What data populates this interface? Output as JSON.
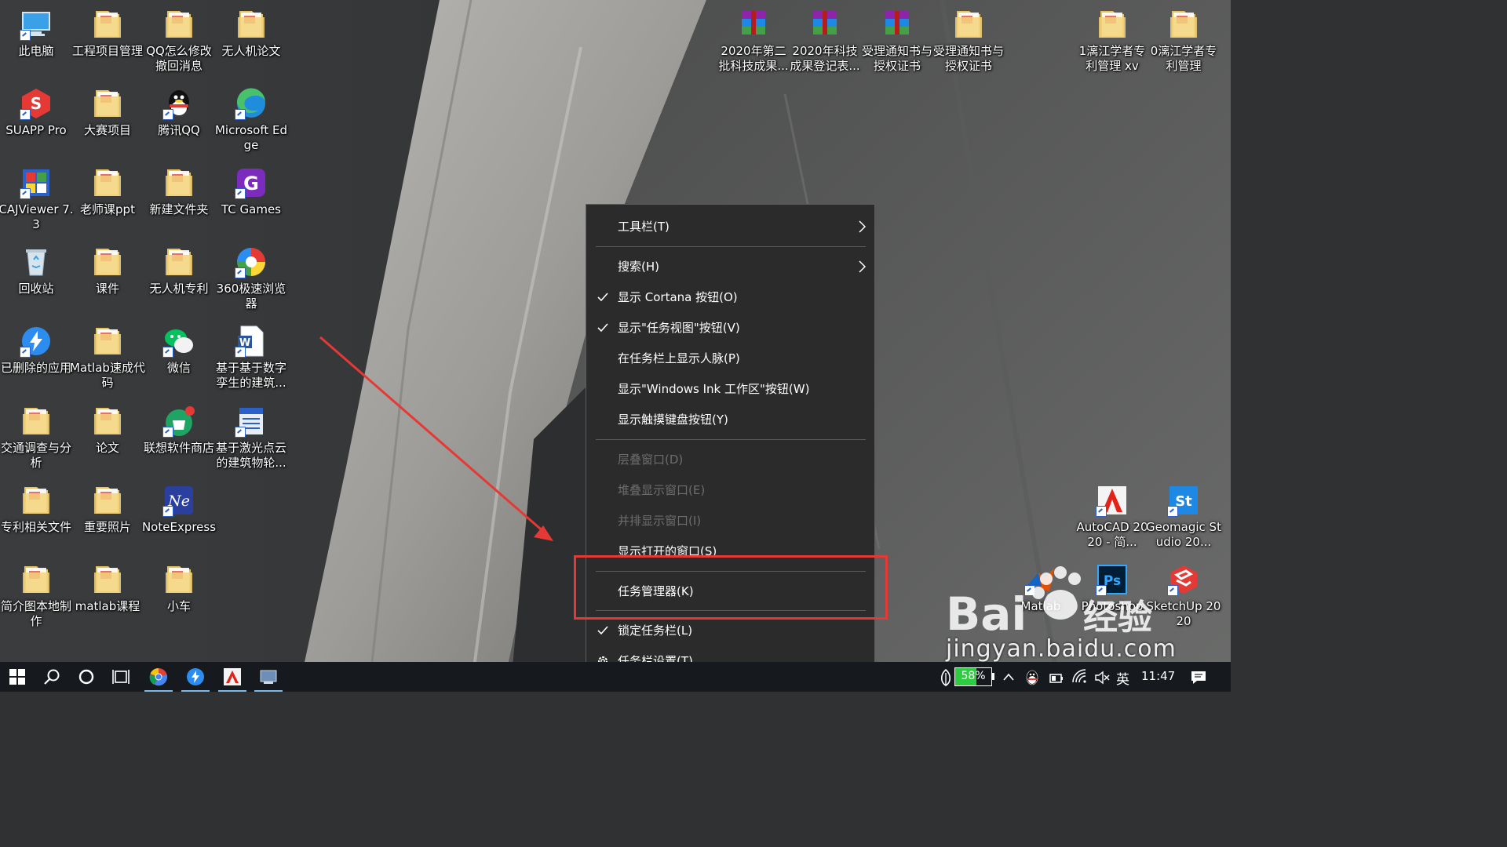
{
  "desktop": {
    "icons_col1": [
      {
        "label": "此电脑",
        "icon": "computer-icon"
      },
      {
        "label": "SUAPP Pro",
        "icon": "suapp-icon"
      },
      {
        "label": "CAJViewer 7.3",
        "icon": "cajviewer-icon"
      },
      {
        "label": "回收站",
        "icon": "recycle-bin-icon"
      },
      {
        "label": "已删除的应用",
        "icon": "deleted-apps-icon"
      },
      {
        "label": "交通调查与分析",
        "icon": "folder-icon"
      },
      {
        "label": "专利相关文件",
        "icon": "folder-icon"
      },
      {
        "label": "简介图本地制作",
        "icon": "folder-icon"
      }
    ],
    "icons_col2": [
      {
        "label": "工程项目管理",
        "icon": "folder-icon"
      },
      {
        "label": "大赛项目",
        "icon": "folder-icon"
      },
      {
        "label": "老师课ppt",
        "icon": "folder-icon"
      },
      {
        "label": "课件",
        "icon": "folder-icon"
      },
      {
        "label": "Matlab速成代码",
        "icon": "folder-icon"
      },
      {
        "label": "论文",
        "icon": "folder-icon"
      },
      {
        "label": "重要照片",
        "icon": "folder-icon"
      },
      {
        "label": "matlab课程",
        "icon": "folder-icon"
      }
    ],
    "icons_col3": [
      {
        "label": "QQ怎么修改撤回消息",
        "icon": "folder-icon"
      },
      {
        "label": "腾讯QQ",
        "icon": "qq-icon"
      },
      {
        "label": "新建文件夹",
        "icon": "folder-icon"
      },
      {
        "label": "无人机专利",
        "icon": "folder-icon"
      },
      {
        "label": "微信",
        "icon": "wechat-icon"
      },
      {
        "label": "联想软件商店",
        "icon": "lenovo-store-icon"
      },
      {
        "label": "NoteExpress",
        "icon": "noteexpress-icon"
      },
      {
        "label": "小车",
        "icon": "folder-icon"
      }
    ],
    "icons_col4": [
      {
        "label": "无人机论文",
        "icon": "folder-icon"
      },
      {
        "label": "Microsoft Edge",
        "icon": "edge-icon"
      },
      {
        "label": "TC Games",
        "icon": "tcgames-icon"
      },
      {
        "label": "360极速浏览器",
        "icon": "browser-360-icon"
      },
      {
        "label": "基于基于数字孪生的建筑...",
        "icon": "word-doc-icon"
      },
      {
        "label": "基于激光点云的建筑物轮...",
        "icon": "caj-doc-icon"
      }
    ],
    "icons_top_right": [
      {
        "label": "2020年第二批科技成果...",
        "icon": "winrar-icon"
      },
      {
        "label": "2020年科技成果登记表...",
        "icon": "winrar-icon"
      },
      {
        "label": "受理通知书与授权证书",
        "icon": "winrar-icon"
      },
      {
        "label": "受理通知书与授权证书",
        "icon": "folder-icon"
      }
    ],
    "icons_far_right": [
      {
        "label": "1漓江学者专利管理 xv",
        "icon": "folder-icon"
      },
      {
        "label": "0漓江学者专利管理",
        "icon": "folder-icon"
      }
    ],
    "icons_bottom_right": [
      {
        "label": "AutoCAD 2020 - 简...",
        "icon": "autocad-icon"
      },
      {
        "label": "Geomagic Studio 20...",
        "icon": "geomagic-icon"
      },
      {
        "label": "Matlab",
        "icon": "matlab-icon"
      },
      {
        "label": "Photoshop",
        "icon": "photoshop-icon"
      },
      {
        "label": "SketchUp 2020",
        "icon": "sketchup-icon"
      }
    ]
  },
  "context_menu": {
    "items": [
      {
        "label": "工具栏(T)",
        "checked": false,
        "disabled": false,
        "submenu": true
      },
      {
        "label": "搜索(H)",
        "checked": false,
        "disabled": false,
        "submenu": true
      },
      {
        "label": "显示 Cortana 按钮(O)",
        "checked": true,
        "disabled": false,
        "submenu": false
      },
      {
        "label": "显示\"任务视图\"按钮(V)",
        "checked": true,
        "disabled": false,
        "submenu": false
      },
      {
        "label": "在任务栏上显示人脉(P)",
        "checked": false,
        "disabled": false,
        "submenu": false
      },
      {
        "label": "显示\"Windows Ink 工作区\"按钮(W)",
        "checked": false,
        "disabled": false,
        "submenu": false
      },
      {
        "label": "显示触摸键盘按钮(Y)",
        "checked": false,
        "disabled": false,
        "submenu": false
      },
      {
        "label": "层叠窗口(D)",
        "checked": false,
        "disabled": true,
        "submenu": false
      },
      {
        "label": "堆叠显示窗口(E)",
        "checked": false,
        "disabled": true,
        "submenu": false
      },
      {
        "label": "并排显示窗口(I)",
        "checked": false,
        "disabled": true,
        "submenu": false
      },
      {
        "label": "显示打开的窗口(S)",
        "checked": false,
        "disabled": false,
        "submenu": false
      },
      {
        "label": "任务管理器(K)",
        "checked": false,
        "disabled": false,
        "submenu": false
      },
      {
        "label": "锁定任务栏(L)",
        "checked": true,
        "disabled": false,
        "submenu": false
      },
      {
        "label": "任务栏设置(T)",
        "checked": false,
        "disabled": false,
        "submenu": false,
        "icon": "gear-icon"
      }
    ]
  },
  "taskbar": {
    "battery_percent": "58%",
    "input_method": "英",
    "clock": "11:47"
  },
  "watermark": {
    "brand": "Bai",
    "brand_cn": "经验",
    "url": "jingyan.baidu.com"
  },
  "colors": {
    "menu_bg": "#2b2b2b",
    "highlight": "#e53935",
    "taskbar_bg": "#16191d",
    "battery_green": "#2ecc40"
  }
}
